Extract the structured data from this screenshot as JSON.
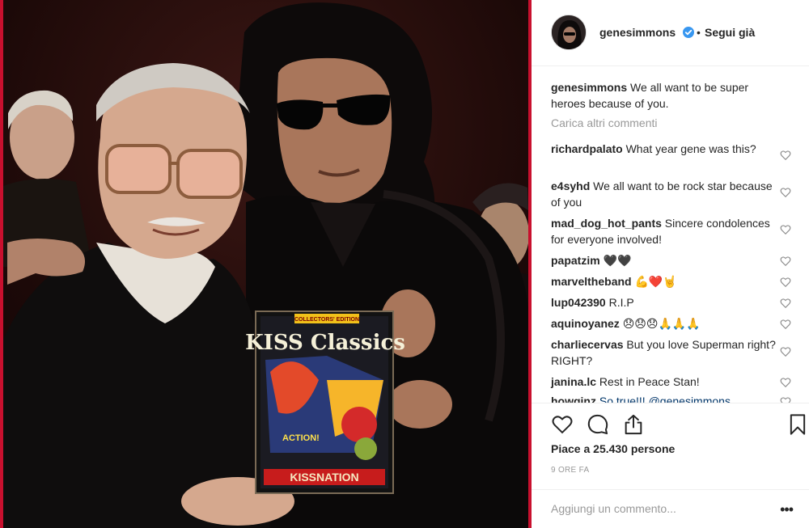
{
  "post": {
    "username": "genesimmons",
    "follow_status": "Segui già",
    "separator": "•",
    "caption": "We all want to be super heroes because of you.",
    "load_more": "Carica altri commenti",
    "likes": "Piace a 25.430 persone",
    "time": "9 ORE FA",
    "add_comment_placeholder": "Aggiungi un commento...",
    "more_options": "•••"
  },
  "comments": [
    {
      "user": "richardpalato",
      "text": "What year gene was this?"
    },
    {
      "user": "e4syhd",
      "text": "We all want to be rock star because of you"
    },
    {
      "user": "mad_dog_hot_pants",
      "text": "Sincere condolences for everyone involved!"
    },
    {
      "user": "papatzim",
      "text": "🖤🖤"
    },
    {
      "user": "marveltheband",
      "text": "💪❤️🤘"
    },
    {
      "user": "lup042390",
      "text": "R.I.P"
    },
    {
      "user": "aquinoyanez",
      "text": "😞😞😞🙏🙏🙏"
    },
    {
      "user": "charliecervas",
      "text": "But you love Superman right? RIGHT?"
    },
    {
      "user": "janina.lc",
      "text": "Rest in Peace Stan!"
    },
    {
      "user": "howginz",
      "text": "So true!!! @genesimmons"
    }
  ],
  "comic": {
    "badge": "COLLECTORS' EDITION",
    "title": "KISS Classics",
    "subtitle": "KISSNATION",
    "action": "ACTION!"
  },
  "colors": {
    "accent": "#c8102e",
    "verified": "#3897f0",
    "muted": "#999999"
  },
  "icons": {
    "like": "heart-icon",
    "comment": "comment-icon",
    "share": "share-icon",
    "save": "bookmark-icon",
    "verified": "verified-badge-icon",
    "comment_like": "heart-outline-icon"
  }
}
